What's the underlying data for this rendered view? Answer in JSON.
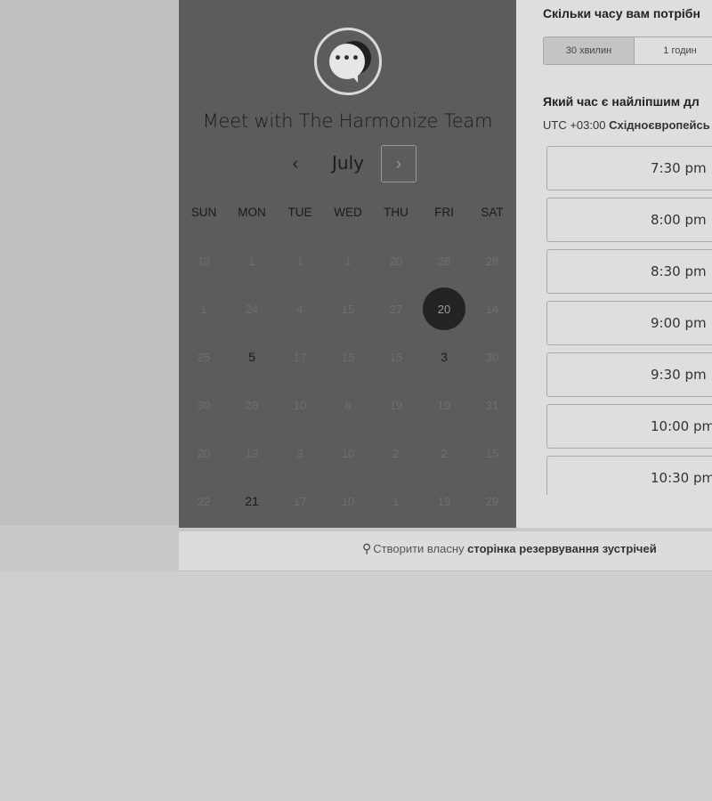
{
  "header": {
    "title": "Meet with The Harmonize Team",
    "avatar_icon": "chat-bubble-icon"
  },
  "calendar": {
    "month": "July",
    "prev_icon": "‹",
    "next_icon": "›",
    "weekdays": [
      "SUN",
      "MON",
      "TUE",
      "WED",
      "THU",
      "FRI",
      "SAT"
    ],
    "weeks": [
      [
        {
          "d": "13"
        },
        {
          "d": "1"
        },
        {
          "d": "1"
        },
        {
          "d": "1"
        },
        {
          "d": "20"
        },
        {
          "d": "28"
        },
        {
          "d": "28"
        }
      ],
      [
        {
          "d": "1"
        },
        {
          "d": "24"
        },
        {
          "d": "4"
        },
        {
          "d": "15"
        },
        {
          "d": "27"
        },
        {
          "d": "20",
          "selected": true
        },
        {
          "d": "14"
        }
      ],
      [
        {
          "d": "25"
        },
        {
          "d": "5",
          "available": true
        },
        {
          "d": "17"
        },
        {
          "d": "15"
        },
        {
          "d": "15"
        },
        {
          "d": "3",
          "available": true
        },
        {
          "d": "30"
        }
      ],
      [
        {
          "d": "30"
        },
        {
          "d": "28"
        },
        {
          "d": "10"
        },
        {
          "d": "6"
        },
        {
          "d": "19"
        },
        {
          "d": "19"
        },
        {
          "d": "31"
        }
      ],
      [
        {
          "d": "20"
        },
        {
          "d": "13"
        },
        {
          "d": "3"
        },
        {
          "d": "10"
        },
        {
          "d": "2"
        },
        {
          "d": "2"
        },
        {
          "d": "15"
        }
      ],
      [
        {
          "d": "22"
        },
        {
          "d": "21",
          "available": true
        },
        {
          "d": "17"
        },
        {
          "d": "10"
        },
        {
          "d": "1"
        },
        {
          "d": "19"
        },
        {
          "d": "29"
        }
      ]
    ]
  },
  "duration": {
    "question": "Скільки часу вам потрібн",
    "options": [
      "30 хвилин",
      "1 годин"
    ],
    "selected_index": 0
  },
  "time_select": {
    "question": "Який час є найліпшим дл",
    "timezone_prefix": "UTC +03:00 ",
    "timezone_name": "Східноєвропейсь",
    "slots": [
      "7:30 pm",
      "8:00 pm",
      "8:30 pm",
      "9:00 pm",
      "9:30 pm",
      "10:00 pm",
      "10:30 pm"
    ]
  },
  "footer": {
    "icon": "hubspot-icon",
    "prefix": "Створити власну ",
    "bold": "сторінка резервування зустрічей"
  }
}
